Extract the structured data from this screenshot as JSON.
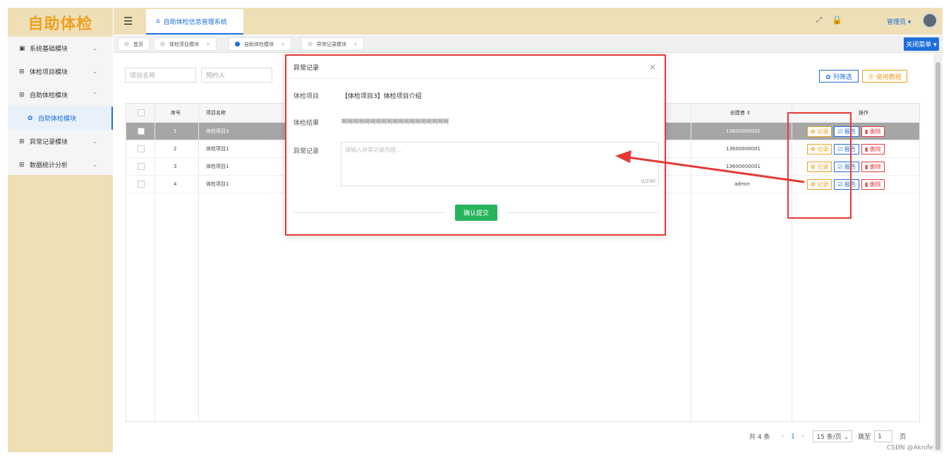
{
  "app": {
    "logo": "自助体检",
    "system_title": "自助体检信息管理系统",
    "user_name": "管理员 ▾"
  },
  "sidebar": {
    "items": [
      {
        "label": "系统基础模块",
        "icon": "system-icon",
        "chevron": "⌄"
      },
      {
        "label": "体检项目模块",
        "icon": "grid-icon",
        "chevron": "⌄"
      },
      {
        "label": "自助体检模块",
        "icon": "grid-icon",
        "chevron": "⌃"
      },
      {
        "label": "自助体检模块",
        "icon": "gear-icon",
        "chevron": ""
      },
      {
        "label": "异常记录模块",
        "icon": "grid-icon",
        "chevron": "⌄"
      },
      {
        "label": "数据统计分析",
        "icon": "grid-icon",
        "chevron": "⌄"
      }
    ]
  },
  "tabs": [
    {
      "label": "首页",
      "closable": false,
      "active": false
    },
    {
      "label": "体检项目模块",
      "closable": true,
      "active": false
    },
    {
      "label": "自助体检模块",
      "closable": true,
      "active": true
    },
    {
      "label": "异常记录模块",
      "closable": true,
      "active": false
    }
  ],
  "tab_close_glyph": "×",
  "close_menu_label": "关闭菜单 ▾",
  "filters": {
    "project_name_placeholder": "项目名称",
    "booker_placeholder": "预约人"
  },
  "toolbar": {
    "column_filter": "✿ 列筛选",
    "tutorial": "⓪ 使用教程"
  },
  "table": {
    "headers": {
      "index": "序号",
      "name": "项目名称",
      "creator": "创建者 ⇕",
      "actions": "操作"
    },
    "rows": [
      {
        "index": "1",
        "name": "体检项目3",
        "creator": "13600000001",
        "selected": true
      },
      {
        "index": "2",
        "name": "体检项目1",
        "creator": "13600000001",
        "selected": false
      },
      {
        "index": "3",
        "name": "体检项目1",
        "creator": "13600000001",
        "selected": false
      },
      {
        "index": "4",
        "name": "体检项目1",
        "creator": "admin",
        "selected": false
      }
    ],
    "action_labels": {
      "record": "✿ 记录",
      "report": "☑ 报告",
      "delete": "▮ 删除"
    }
  },
  "pagination": {
    "total": "共 4 条",
    "prev": "‹",
    "current_page": "1",
    "next": "›",
    "page_size": "15 条/页 ⌄",
    "goto_label": "跳至",
    "goto_value": "1",
    "page_suffix": "页"
  },
  "modal": {
    "title": "异常记录",
    "close": "×",
    "project_label": "体检项目",
    "project_value": "【体检项目3】体检项目介绍",
    "result_label": "体检结果",
    "result_value": "啊啊啊啊啊啊啊啊啊啊啊啊啊啊啊啊啊啊啊",
    "record_label": "异常记录",
    "record_placeholder": "请输入异常记录内容...",
    "counter": "0/240",
    "confirm": "确认提交"
  },
  "watermark": "CSDN @Aknife",
  "colors": {
    "accent": "#1e6fd9",
    "sidebar_bg": "#eedfb6",
    "annotation": "#e53935",
    "confirm": "#27b35a"
  }
}
